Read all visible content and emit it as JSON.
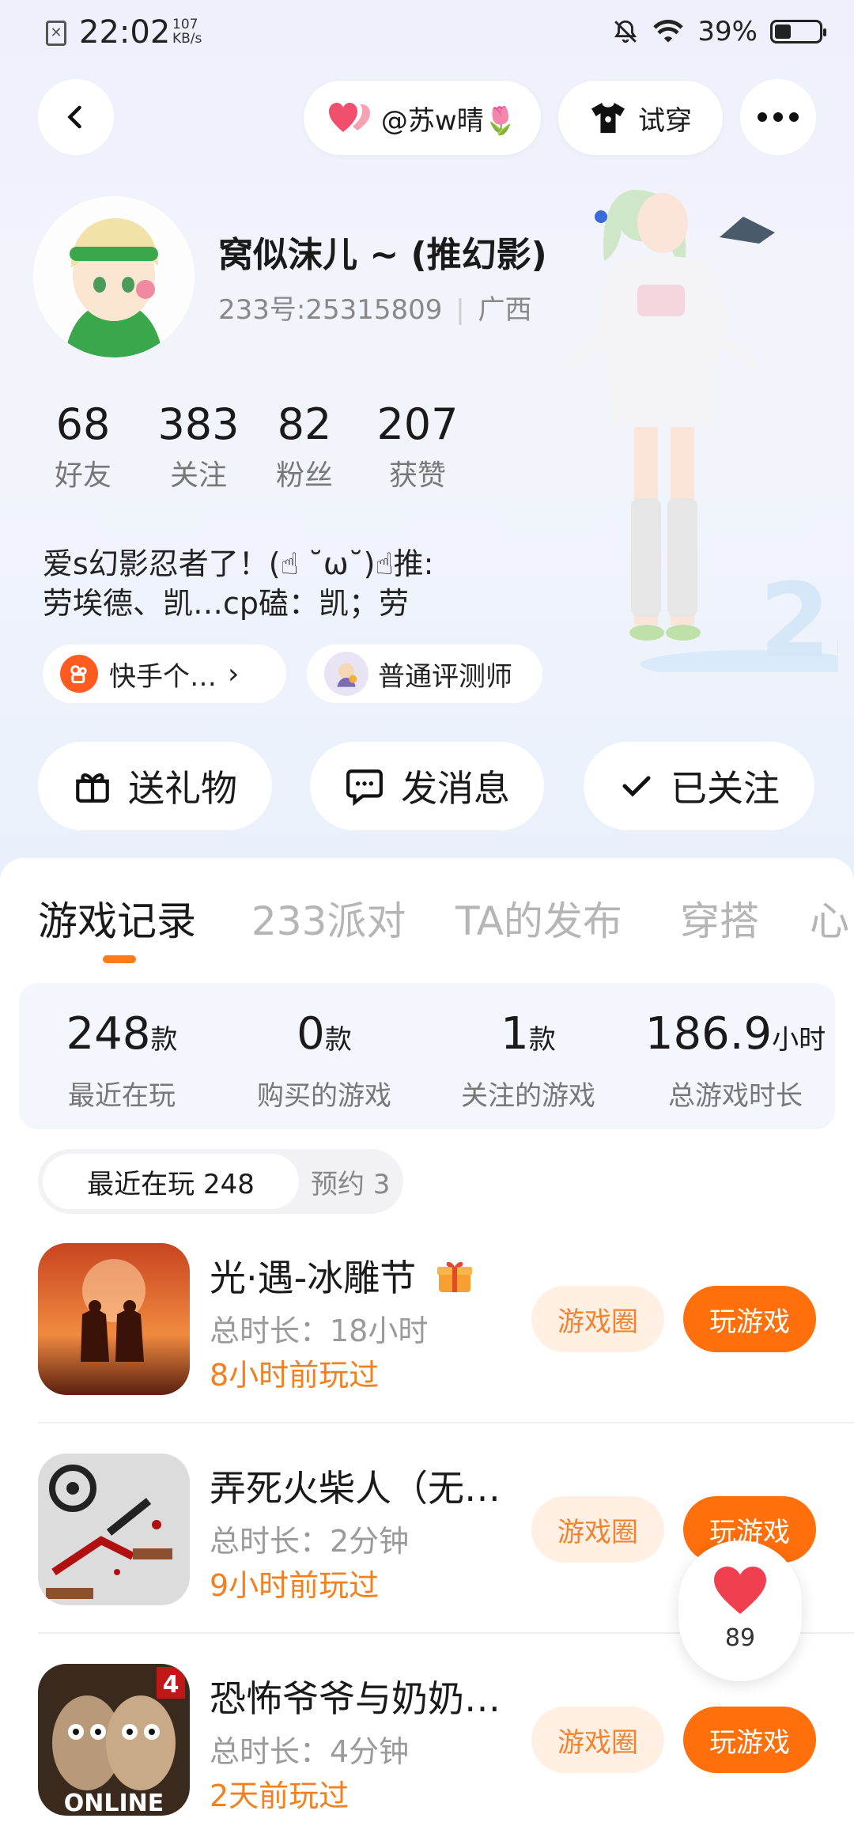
{
  "status_bar": {
    "time": "22:02",
    "speed_value": "107",
    "speed_unit": "KB/s",
    "battery": "39%"
  },
  "header": {
    "couple_label": "@苏w晴🌷",
    "try_on_label": "试穿"
  },
  "profile": {
    "name": "窝似沫儿 ~ (推幻影)",
    "uid": "233号:25315809",
    "region": "广西",
    "stats": [
      {
        "value": "68",
        "label": "好友"
      },
      {
        "value": "383",
        "label": "关注"
      },
      {
        "value": "82",
        "label": "粉丝"
      },
      {
        "value": "207",
        "label": "获赞"
      }
    ],
    "bio_line1": "爱s幻影忍者了！(☝ ˘ω˘)☝推:",
    "bio_line2": "劳埃德、凯…cp磕：凯；劳",
    "tags": [
      {
        "label": "快手个…",
        "arrow": "›"
      },
      {
        "label": "普通评测师"
      }
    ],
    "actions": [
      {
        "label": "送礼物",
        "icon": "gift-icon"
      },
      {
        "label": "发消息",
        "icon": "message-icon"
      },
      {
        "label": "已关注",
        "icon": "check-icon"
      }
    ]
  },
  "tabs": [
    "游戏记录",
    "233派对",
    "TA的发布",
    "穿搭",
    "心"
  ],
  "game_stats": [
    {
      "value": "248",
      "unit": "款",
      "label": "最近在玩"
    },
    {
      "value": "0",
      "unit": "款",
      "label": "购买的游戏"
    },
    {
      "value": "1",
      "unit": "款",
      "label": "关注的游戏"
    },
    {
      "value": "186.9",
      "unit": "小时",
      "label": "总游戏时长"
    }
  ],
  "segment": {
    "active": "最近在玩 248",
    "inactive": "预约 3"
  },
  "games": [
    {
      "title": "光·遇-冰雕节",
      "duration": "总时长：18小时",
      "last_played": "8小时前玩过",
      "circle_btn": "游戏圈",
      "play_btn": "玩游戏"
    },
    {
      "title": "弄死火柴人（无…",
      "duration": "总时长：2分钟",
      "last_played": "9小时前玩过",
      "circle_btn": "游戏圈",
      "play_btn": "玩游戏"
    },
    {
      "title": "恐怖爷爷与奶奶…",
      "duration": "总时长：4分钟",
      "last_played": "2天前玩过",
      "circle_btn": "游戏圈",
      "play_btn": "玩游戏",
      "icon_badge": "4",
      "icon_text": "ONLINE"
    }
  ],
  "like_fab": {
    "count": "89"
  },
  "colors": {
    "accent": "#ff6f0c",
    "accent_light": "#fff0e3",
    "like": "#f04050"
  }
}
